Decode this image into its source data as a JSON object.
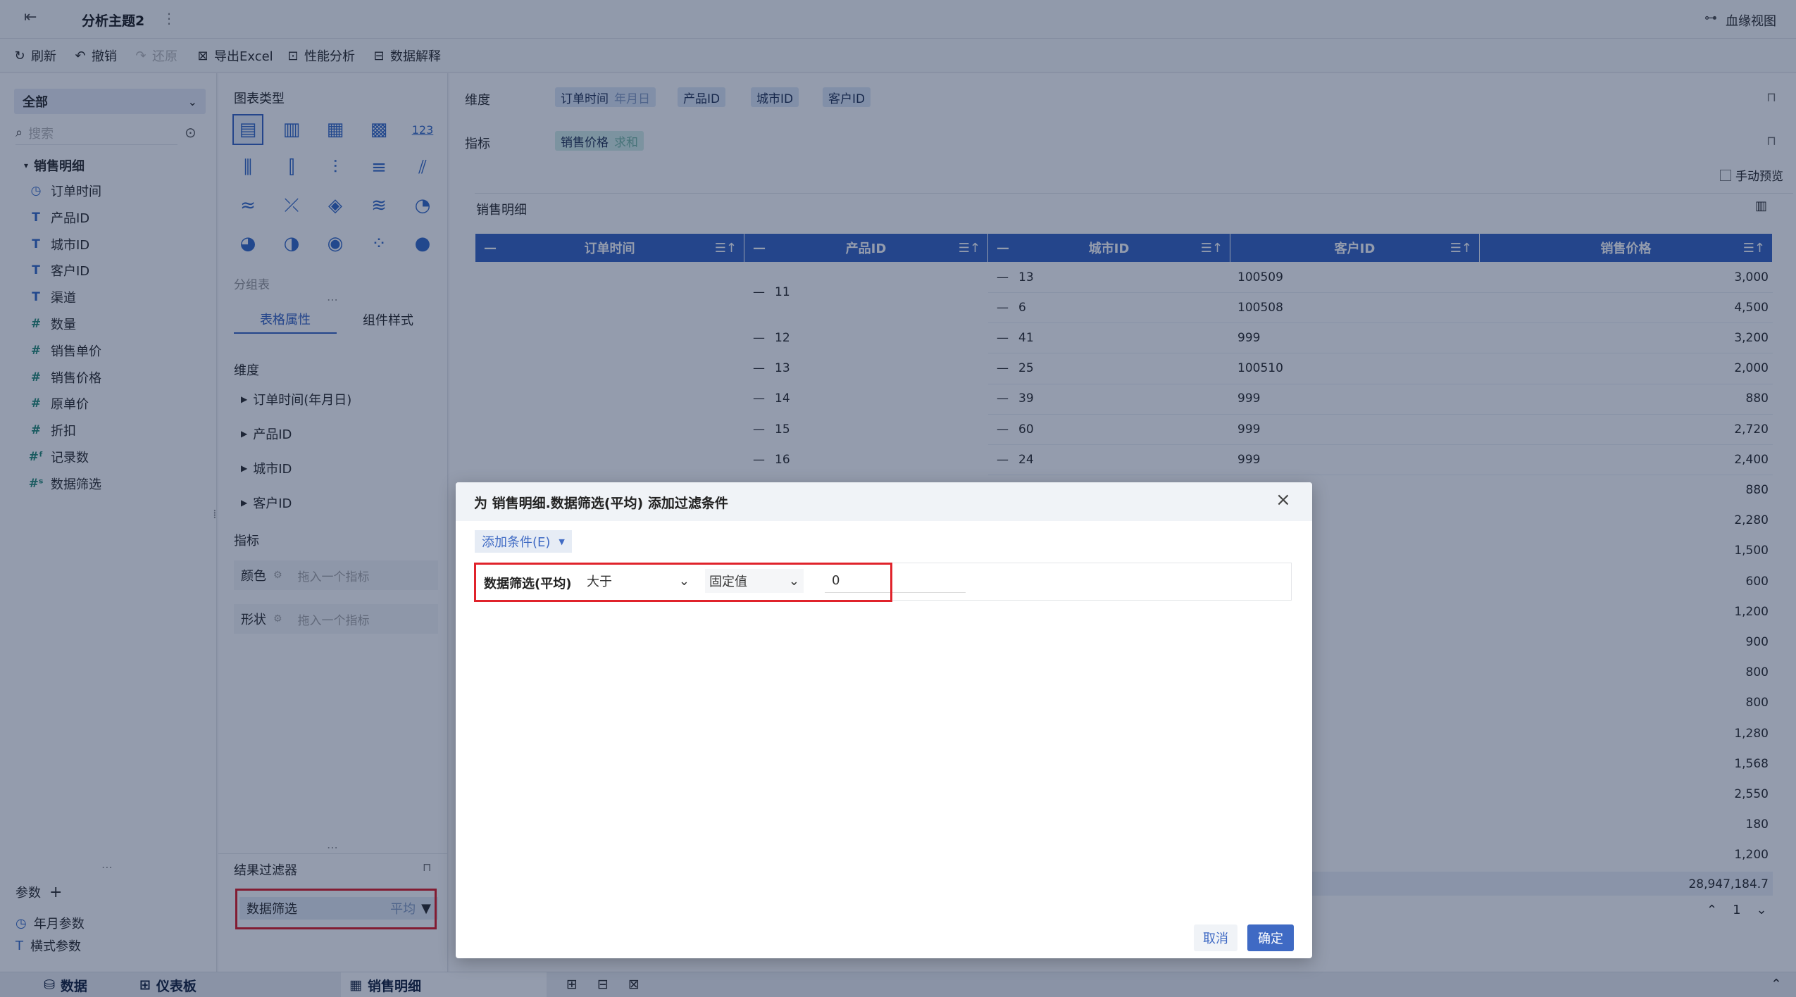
{
  "title_bar": {
    "back_icon": "back-arrow-icon",
    "subject_name": "分析主题2",
    "more_icon": "vertical-dots-icon",
    "lineage_label": "血缘视图"
  },
  "toolbar": {
    "refresh": "刷新",
    "undo": "撤销",
    "redo": "还原",
    "export_excel": "导出Excel",
    "performance": "性能分析",
    "data_explain": "数据解释"
  },
  "left_panel": {
    "scope_select": "全部",
    "search_placeholder": "搜索",
    "table_name": "销售明细",
    "fields": [
      {
        "icon": "clock",
        "label": "订单时间"
      },
      {
        "icon": "T",
        "label": "产品ID"
      },
      {
        "icon": "T",
        "label": "城市ID"
      },
      {
        "icon": "T",
        "label": "客户ID"
      },
      {
        "icon": "T",
        "label": "渠道"
      },
      {
        "icon": "#",
        "label": "数量"
      },
      {
        "icon": "#",
        "label": "销售单价"
      },
      {
        "icon": "#",
        "label": "销售价格"
      },
      {
        "icon": "#",
        "label": "原单价"
      },
      {
        "icon": "#",
        "label": "折扣"
      },
      {
        "icon": "#f",
        "label": "记录数"
      },
      {
        "icon": "#s",
        "label": "数据筛选"
      }
    ],
    "params_title": "参数",
    "params": [
      "年月参数",
      "横式参数"
    ]
  },
  "mid_panel": {
    "chart_type_title": "图表类型",
    "group_table_label": "分组表",
    "tabs": [
      "表格属性",
      "组件样式"
    ],
    "dimension_title": "维度",
    "dimensions": [
      "订单时间(年月日)",
      "产品ID",
      "城市ID",
      "客户ID"
    ],
    "metric_title": "指标",
    "color_label": "颜色",
    "shape_label": "形状",
    "drop_hint": "拖入一个指标",
    "result_filter_title": "结果过滤器",
    "filter_field": "数据筛选",
    "filter_agg": "平均"
  },
  "main": {
    "dimension_label": "维度",
    "dimension_pills": [
      {
        "name": "订单时间",
        "sub": "年月日"
      },
      {
        "name": "产品ID",
        "sub": ""
      },
      {
        "name": "城市ID",
        "sub": ""
      },
      {
        "name": "客户ID",
        "sub": ""
      }
    ],
    "metric_label": "指标",
    "metric_pill": {
      "name": "销售价格",
      "sub": "求和"
    },
    "manual_preview": "手动预览",
    "widget_title": "销售明细",
    "columns": [
      "订单时间",
      "产品ID",
      "城市ID",
      "客户ID",
      "销售价格"
    ],
    "rows": [
      {
        "product": "11",
        "city": "13",
        "customer": "100509",
        "price": "3,000"
      },
      {
        "product": "",
        "city": "6",
        "customer": "100508",
        "price": "4,500"
      },
      {
        "product": "12",
        "city": "41",
        "customer": "999",
        "price": "3,200"
      },
      {
        "product": "13",
        "city": "25",
        "customer": "100510",
        "price": "2,000"
      },
      {
        "product": "14",
        "city": "39",
        "customer": "999",
        "price": "880"
      },
      {
        "product": "15",
        "city": "60",
        "customer": "999",
        "price": "2,720"
      },
      {
        "product": "16",
        "city": "24",
        "customer": "999",
        "price": "2,400"
      }
    ],
    "hidden_prices": [
      "880",
      "2,280",
      "1,500",
      "600",
      "1,200",
      "900",
      "800",
      "800",
      "1,280",
      "1,568",
      "2,550",
      "180",
      "1,200"
    ],
    "total": "28,947,184.7",
    "page": "1"
  },
  "dialog": {
    "title": "为 销售明细.数据筛选(平均) 添加过滤条件",
    "add_condition": "添加条件(E)",
    "condition_field": "数据筛选(平均)",
    "operator": "大于",
    "value_type": "固定值",
    "value": "0",
    "cancel": "取消",
    "confirm": "确定"
  },
  "bottom_bar": {
    "data_tab": "数据",
    "dashboard_tab": "仪表板",
    "sheet_tab": "销售明细"
  },
  "colors": {
    "accent": "#3f6ac4",
    "highlight_red": "#e0232b"
  }
}
